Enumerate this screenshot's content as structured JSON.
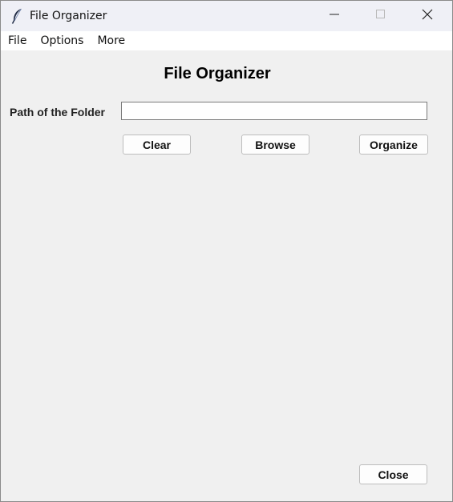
{
  "window": {
    "title": "File Organizer",
    "controls": {
      "minimize": "minimize",
      "maximize": "maximize",
      "close": "close"
    }
  },
  "menubar": {
    "items": [
      "File",
      "Options",
      "More"
    ]
  },
  "main": {
    "heading": "File Organizer",
    "path_label": "Path of the Folder",
    "path_value": "",
    "buttons": {
      "clear": "Clear",
      "browse": "Browse",
      "organize": "Organize",
      "close": "Close"
    }
  },
  "icons": {
    "app": "feather-icon",
    "minimize": "minimize-icon",
    "maximize": "maximize-icon",
    "close": "close-icon"
  }
}
